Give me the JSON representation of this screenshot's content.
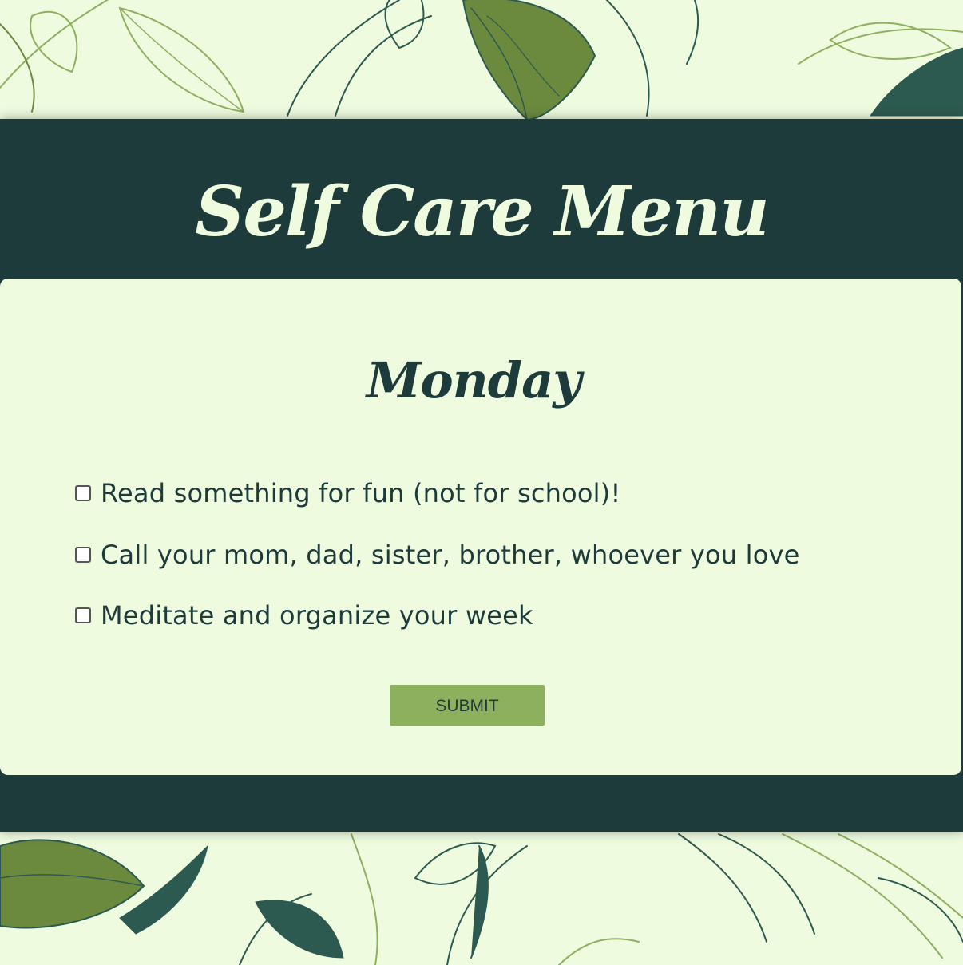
{
  "header": {
    "title": "Self Care Menu"
  },
  "card": {
    "day": "Monday",
    "tasks": [
      {
        "label": "Read something for fun (not for school)!",
        "checked": false
      },
      {
        "label": "Call your mom, dad, sister, brother, whoever you love",
        "checked": false
      },
      {
        "label": "Meditate and organize your week",
        "checked": false
      }
    ],
    "submit_label": "SUBMIT"
  },
  "colors": {
    "background": "#eefbdf",
    "panel": "#1e3b3b",
    "accent": "#8db05e",
    "leaf_dark": "#2d5a50",
    "leaf_olive": "#6b8a3e",
    "leaf_light": "#8db05e"
  },
  "background_decoration": "leaf-pattern"
}
